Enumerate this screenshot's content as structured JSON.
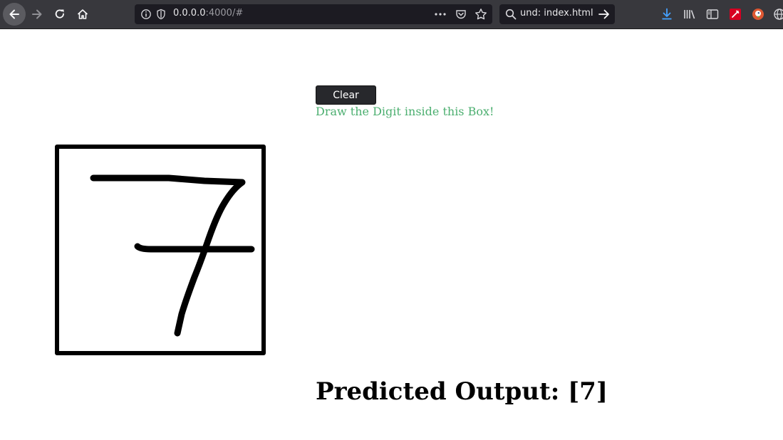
{
  "browser": {
    "url_host": "0.0.0.0",
    "url_rest": ":4000/#",
    "search_value": "und: index.html",
    "icons": {
      "back": "arrow-left-icon",
      "forward": "arrow-right-icon",
      "reload": "reload-icon",
      "home": "home-icon",
      "info": "info-icon",
      "shield": "shield-icon",
      "more": "more-icon",
      "pocket": "pocket-icon",
      "star": "star-icon",
      "search": "search-icon",
      "go": "go-arrow-icon",
      "downloads": "download-icon",
      "library": "library-icon",
      "sidebar": "sidebar-icon",
      "ext1": "extension-red-icon",
      "ext2": "duckduckgo-icon",
      "ext3": "globe-icon"
    }
  },
  "page": {
    "clear_label": "Clear",
    "instruction": "Draw the Digit inside this Box!",
    "prediction": "Predicted Output: [7]",
    "colors": {
      "instruction": "#4caf70",
      "button_bg": "#27282c",
      "toolbar_bg": "#38383d"
    }
  }
}
